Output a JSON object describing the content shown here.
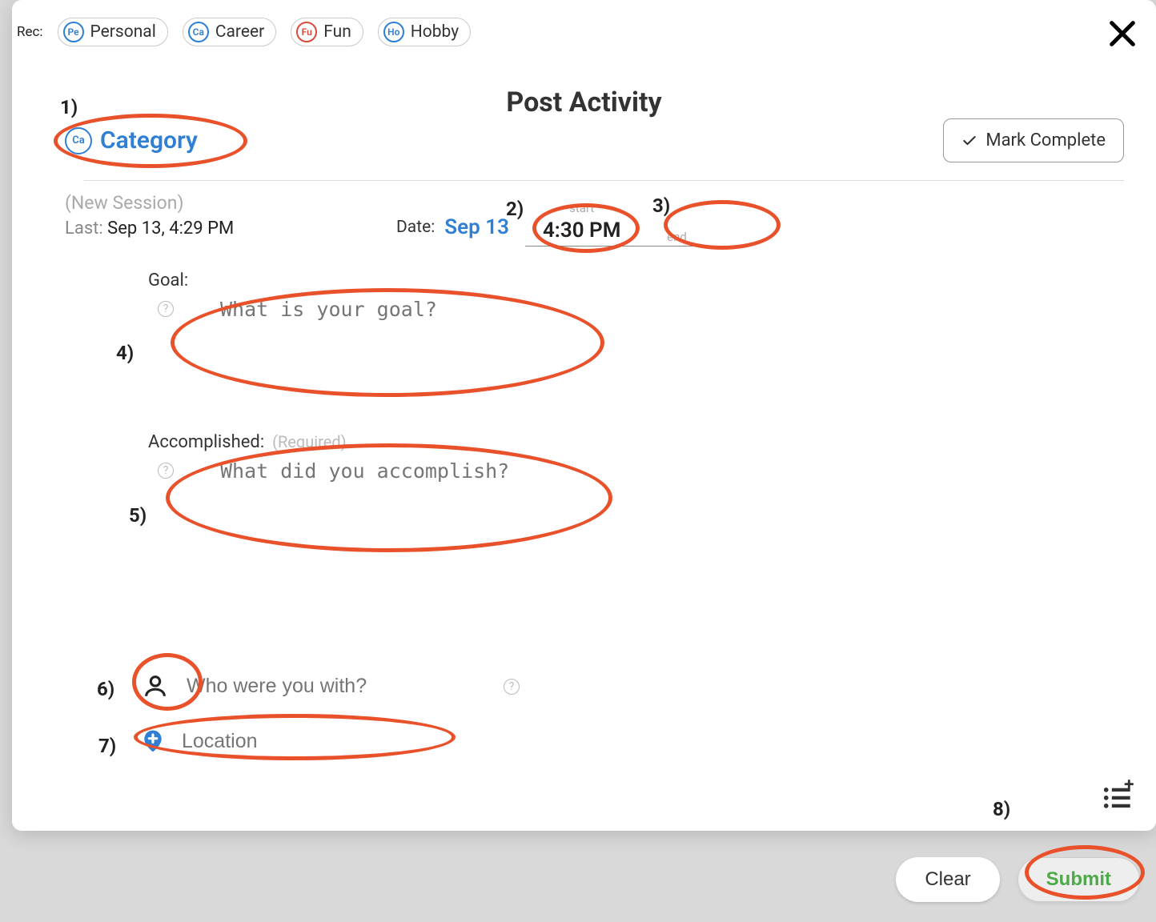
{
  "rec": {
    "label": "Rec:",
    "chips": [
      {
        "badge": "Pe",
        "label": "Personal",
        "badgeClass": "b-pe"
      },
      {
        "badge": "Ca",
        "label": "Career",
        "badgeClass": "b-ca"
      },
      {
        "badge": "Fu",
        "label": "Fun",
        "badgeClass": "b-fu"
      },
      {
        "badge": "Ho",
        "label": "Hobby",
        "badgeClass": "b-ho"
      }
    ]
  },
  "title": "Post Activity",
  "markers": {
    "1": "1)",
    "2": "2)",
    "3": "3)",
    "4": "4)",
    "5": "5)",
    "6": "6)",
    "7": "7)",
    "8": "8)"
  },
  "category": {
    "badge": "Ca",
    "label": "Category"
  },
  "markComplete": "Mark Complete",
  "session": {
    "new": "(New Session)",
    "lastLabel": "Last:",
    "lastValue": "Sep 13, 4:29 PM"
  },
  "date": {
    "label": "Date:",
    "value": "Sep 13",
    "startLabel": "start",
    "startValue": "4:30 PM",
    "endLabel": "end",
    "endValue": ""
  },
  "goal": {
    "label": "Goal:",
    "placeholder": "What is your goal?"
  },
  "accomplished": {
    "label": "Accomplished:",
    "required": "(Required)",
    "placeholder": "What did you accomplish?"
  },
  "who": {
    "placeholder": "Who were you with?"
  },
  "location": {
    "placeholder": "Location"
  },
  "buttons": {
    "clear": "Clear",
    "submit": "Submit"
  },
  "bgLetter": "n"
}
